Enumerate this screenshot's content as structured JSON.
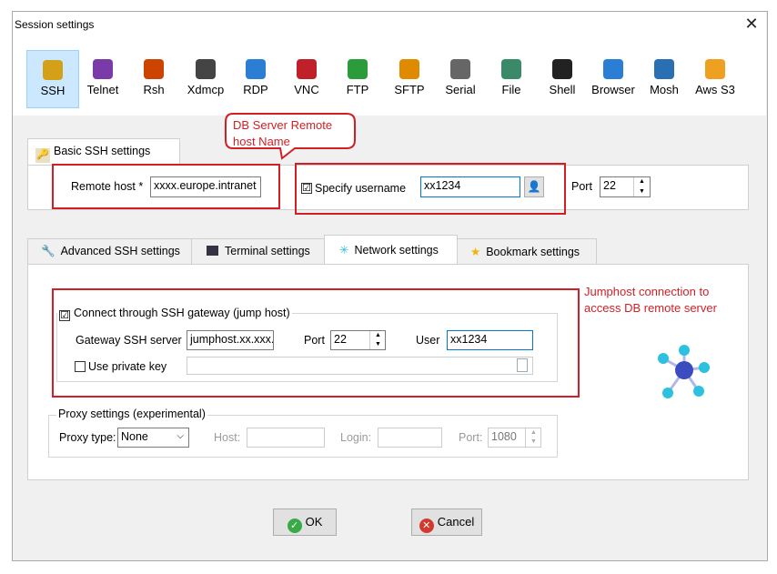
{
  "window": {
    "title": "Session settings"
  },
  "protocols": [
    {
      "label": "SSH",
      "icon": "ssh-key-icon",
      "color": "#d4a017"
    },
    {
      "label": "Telnet",
      "icon": "telnet-icon",
      "color": "#7a3aa8"
    },
    {
      "label": "Rsh",
      "icon": "rsh-icon",
      "color": "#cc4400"
    },
    {
      "label": "Xdmcp",
      "icon": "xdmcp-icon",
      "color": "#444444"
    },
    {
      "label": "RDP",
      "icon": "rdp-icon",
      "color": "#2a7fd4"
    },
    {
      "label": "VNC",
      "icon": "vnc-icon",
      "color": "#c0202a"
    },
    {
      "label": "FTP",
      "icon": "ftp-icon",
      "color": "#2a9d3a"
    },
    {
      "label": "SFTP",
      "icon": "sftp-icon",
      "color": "#e08a00"
    },
    {
      "label": "Serial",
      "icon": "serial-icon",
      "color": "#666666"
    },
    {
      "label": "File",
      "icon": "file-icon",
      "color": "#3a8a6a"
    },
    {
      "label": "Shell",
      "icon": "shell-icon",
      "color": "#222222"
    },
    {
      "label": "Browser",
      "icon": "browser-icon",
      "color": "#2a7fd4"
    },
    {
      "label": "Mosh",
      "icon": "mosh-icon",
      "color": "#2a6fb4"
    },
    {
      "label": "Aws S3",
      "icon": "aws-s3-icon",
      "color": "#f0a020"
    }
  ],
  "basic": {
    "tab_label": "Basic SSH settings",
    "remote_host_label": "Remote host *",
    "remote_host_value": "xxxx.europe.intranet",
    "specify_username_label": "Specify username",
    "specify_username_checked": "☑",
    "username_value": "xx1234",
    "port_label": "Port",
    "port_value": "22"
  },
  "tabs": [
    {
      "label": "Advanced SSH settings",
      "icon": "wrench-icon"
    },
    {
      "label": "Terminal settings",
      "icon": "terminal-icon"
    },
    {
      "label": "Network settings",
      "icon": "network-icon"
    },
    {
      "label": "Bookmark settings",
      "icon": "star-icon"
    }
  ],
  "network": {
    "gateway_group_label": "Connect through SSH gateway (jump host)",
    "gateway_checked": "☑",
    "gateway_server_label": "Gateway SSH server",
    "gateway_server_value": "jumphost.xx.xxx.i",
    "port_label": "Port",
    "port_value": "22",
    "user_label": "User",
    "user_value": "xx1234",
    "use_private_key_label": "Use private key",
    "proxy_group_label": "Proxy settings (experimental)",
    "proxy_type_label": "Proxy type:",
    "proxy_type_value": "None",
    "host_label": "Host:",
    "login_label": "Login:",
    "proxy_port_label": "Port:",
    "proxy_port_value": "1080"
  },
  "annotations": {
    "db_note": "DB Server Remote\nhost Name",
    "jump_note": "Jumphost connection to\naccess DB remote server"
  },
  "buttons": {
    "ok": "OK",
    "cancel": "Cancel"
  },
  "colors": {
    "accent": "#0078d7",
    "annotation": "#d21f26",
    "network_node": "#2ec0e0",
    "network_hub": "#3b4cc0"
  }
}
